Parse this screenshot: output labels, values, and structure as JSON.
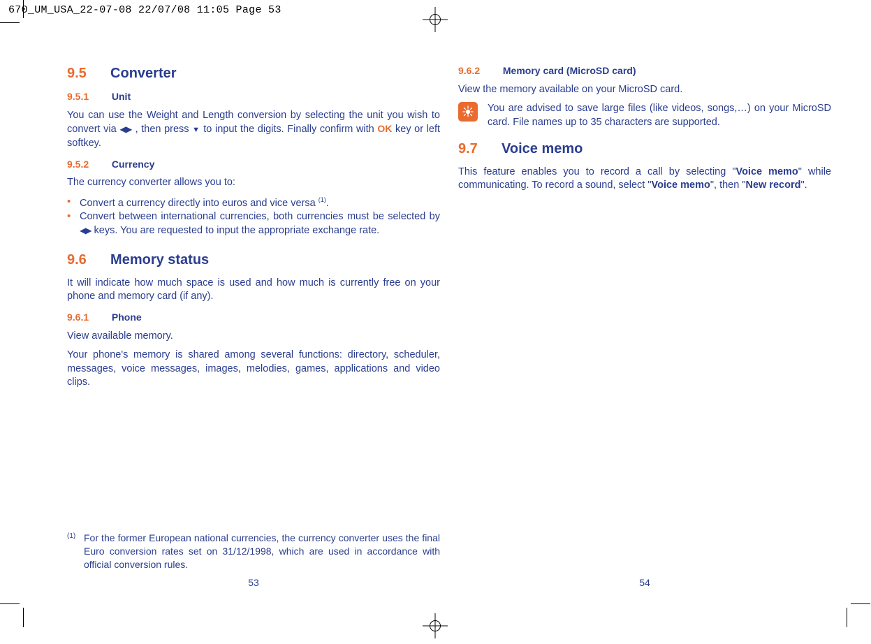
{
  "print_header": "670_UM_USA_22-07-08  22/07/08  11:05  Page 53",
  "left": {
    "sec95_num": "9.5",
    "sec95_title": "Converter",
    "sub951_num": "9.5.1",
    "sub951_title": "Unit",
    "p951a": "You can use the Weight and Length conversion by selecting the unit you wish to convert via ",
    "p951b": ", then press ",
    "p951c": " to input the digits. Finally confirm with ",
    "p951d": " key or left softkey.",
    "sub952_num": "9.5.2",
    "sub952_title": "Currency",
    "p952_intro": "The currency converter allows you to:",
    "li1a": "Convert a currency directly into euros and vice versa ",
    "li1sup": "(1)",
    "li1b": ".",
    "li2a": "Convert between international currencies, both currencies must be selected by ",
    "li2b": " keys. You are requested to input the appropriate exchange rate.",
    "sec96_num": "9.6",
    "sec96_title": "Memory status",
    "p96": "It will indicate how much space is used and how much is currently free on your phone and memory card (if any).",
    "sub961_num": "9.6.1",
    "sub961_title": "Phone",
    "p961a": "View available memory.",
    "p961b": "Your phone's memory is shared among several functions: directory, scheduler, messages, voice messages, images, melodies, games, applications and video clips.",
    "foot_marker": "(1)",
    "foot_text": "For the former European national currencies, the currency converter uses the final Euro conversion rates set on 31/12/1998, which are used in accordance with official conversion rules.",
    "pagenum": "53",
    "ok_glyph": "OK"
  },
  "right": {
    "sub962_num": "9.6.2",
    "sub962_title": "Memory card (MicroSD card)",
    "p962": "View the memory available on your MicroSD card.",
    "tip": "You are advised to save large files (like videos, songs,…) on your MicroSD card. File names up to 35 characters are supported.",
    "sec97_num": "9.7",
    "sec97_title": "Voice memo",
    "p97a": "This feature enables you to record a call by selecting \"",
    "p97b": "Voice memo",
    "p97c": "\" while communicating. To record a sound, select \"",
    "p97d": "Voice memo",
    "p97e": "\", then \"",
    "p97f": "New record",
    "p97g": "\".",
    "pagenum": "54"
  }
}
